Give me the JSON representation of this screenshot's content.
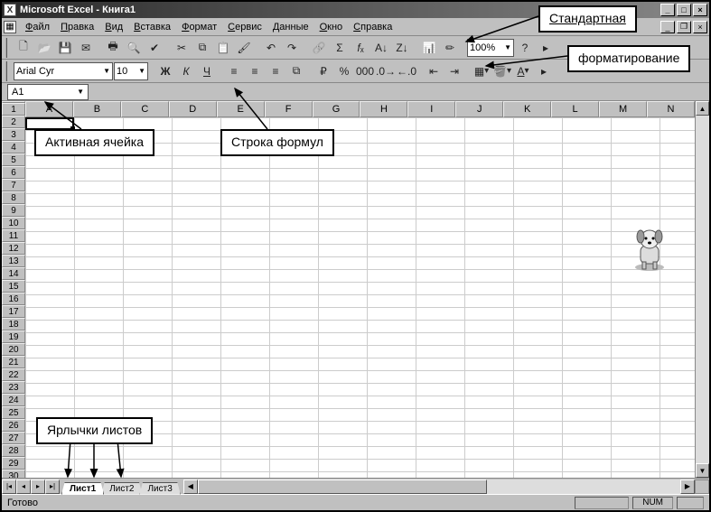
{
  "title": "Microsoft Excel - Книга1",
  "menus": [
    "Файл",
    "Правка",
    "Вид",
    "Вставка",
    "Формат",
    "Сервис",
    "Данные",
    "Окно",
    "Справка"
  ],
  "toolbar_standard": {
    "zoom": "100%",
    "icons": [
      "new",
      "open",
      "save",
      "mail",
      "print",
      "preview",
      "spell",
      "cut",
      "copy",
      "paste",
      "format-painter",
      "undo",
      "redo",
      "hyperlink",
      "autosum",
      "function",
      "sort-asc",
      "sort-desc",
      "chart",
      "drawing",
      "zoom",
      "help"
    ]
  },
  "toolbar_formatting": {
    "font": "Arial Cyr",
    "size": "10",
    "icons": [
      "bold",
      "italic",
      "underline",
      "align-left",
      "align-center",
      "align-right",
      "merge",
      "currency",
      "percent",
      "comma",
      "inc-dec",
      "dec-dec",
      "dec-indent",
      "inc-indent",
      "borders",
      "fill-color",
      "font-color"
    ]
  },
  "namebox": "A1",
  "columns": [
    "A",
    "B",
    "C",
    "D",
    "E",
    "F",
    "G",
    "H",
    "I",
    "J",
    "K",
    "L",
    "M",
    "N"
  ],
  "row_count": 31,
  "sheets": [
    "Лист1",
    "Лист2",
    "Лист3"
  ],
  "active_sheet": 0,
  "status": {
    "ready": "Готово",
    "num": "NUM"
  },
  "annotations": {
    "standard": "Стандартная",
    "formatting": "форматирование",
    "active_cell": "Активная ячейка",
    "formula_bar": "Строка формул",
    "sheet_tabs": "Ярлычки листов"
  }
}
